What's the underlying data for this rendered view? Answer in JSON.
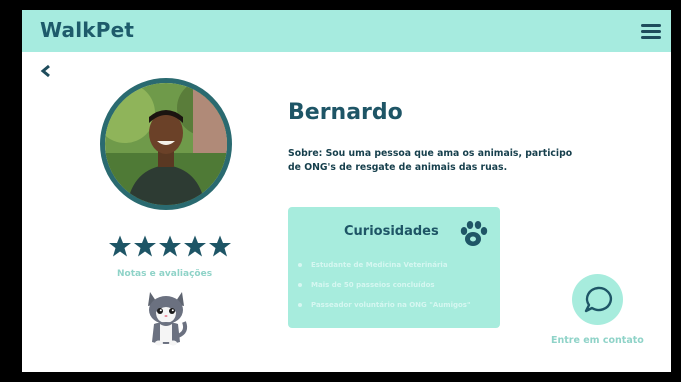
{
  "app": {
    "logo": "WalkPet"
  },
  "header": {
    "menu_icon": "hamburger-menu-icon",
    "back_icon": "chevron-left-icon"
  },
  "profile": {
    "name": "Bernardo",
    "about": "Sobre: Sou uma pessoa que ama os animais, participo de ONG's de resgate de animais das ruas.",
    "rating": {
      "stars": 5,
      "max": 5,
      "label": "Notas e avaliações"
    }
  },
  "curiosities": {
    "title": "Curiosidades",
    "icon": "paw-icon",
    "items": [
      "Estudante de Medicina Veterinária",
      "Mais de 50 passeios concluídos",
      "Passeador voluntário na ONG \"Aumigos\""
    ]
  },
  "contact": {
    "label": "Entre em contato",
    "icon": "chat-bubble-icon"
  },
  "colors": {
    "header_bg": "#a6ebdf",
    "primary_dark": "#1e5566",
    "accent_light": "#a7ecdd",
    "muted_label": "#8fd3c8"
  }
}
